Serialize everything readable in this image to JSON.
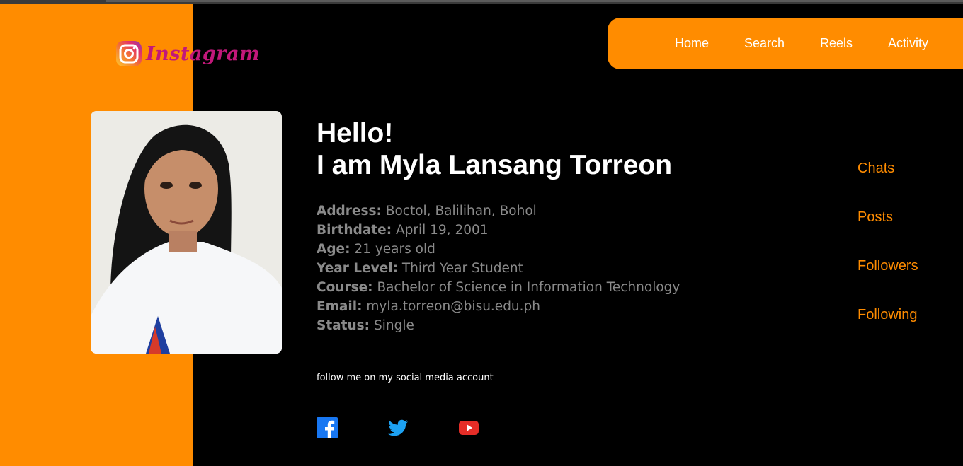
{
  "brand": {
    "name": "Instagram",
    "icon": "instagram-icon"
  },
  "nav": [
    "Home",
    "Search",
    "Reels",
    "Activity"
  ],
  "hero": {
    "line1": "Hello!",
    "line2": "I am Myla Lansang Torreon"
  },
  "details": [
    {
      "label": "Address:",
      "value": "Boctol, Balilihan, Bohol"
    },
    {
      "label": "Birthdate:",
      "value": "April 19, 2001"
    },
    {
      "label": "Age:",
      "value": "21 years old"
    },
    {
      "label": "Year Level:",
      "value": "Third Year Student"
    },
    {
      "label": "Course:",
      "value": "Bachelor of Science in Information Technology"
    },
    {
      "label": "Email:",
      "value": "myla.torreon@bisu.edu.ph"
    },
    {
      "label": "Status:",
      "value": "Single"
    }
  ],
  "follow_text": "follow me on my social media account",
  "social_icons": [
    "facebook-icon",
    "twitter-icon",
    "youtube-icon"
  ],
  "side_links": [
    "Chats",
    "Posts",
    "Followers",
    "Following"
  ],
  "colors": {
    "accent": "#ff8c00",
    "background": "#000000",
    "brand_text": "#c2187a",
    "detail_text": "#8a8a8a"
  }
}
